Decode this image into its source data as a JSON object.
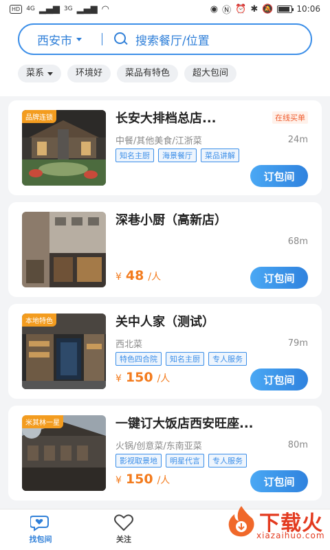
{
  "status_bar": {
    "left_badge": "HD",
    "signal_1": "4G",
    "signal_2": "3G",
    "time": "10:06"
  },
  "search": {
    "city": "西安市",
    "placeholder": "搜索餐厅/位置"
  },
  "filters": [
    "菜系",
    "环境好",
    "菜品有特色",
    "超大包间"
  ],
  "restaurants": [
    {
      "badge": "品牌连锁",
      "name": "长安大排档总店...",
      "online_label": "在线买单",
      "cuisine": "中餐/其他美食/江浙菜",
      "distance": "24m",
      "tags": [
        "知名主厨",
        "海景餐厅",
        "菜品讲解"
      ],
      "price_symbol": "",
      "price": "",
      "price_unit": "",
      "button": "订包间"
    },
    {
      "badge": "",
      "name": "深巷小厨（高新店）",
      "online_label": "",
      "cuisine": "",
      "distance": "68m",
      "tags": [],
      "price_symbol": "¥",
      "price": "48",
      "price_unit": "/人",
      "button": "订包间"
    },
    {
      "badge": "本地特色",
      "name": "关中人家（测试）",
      "online_label": "",
      "cuisine": "西北菜",
      "distance": "79m",
      "tags": [
        "特色四合院",
        "知名主厨",
        "专人服务"
      ],
      "price_symbol": "¥",
      "price": "150",
      "price_unit": "/人",
      "button": "订包间"
    },
    {
      "badge": "米其林一星",
      "name": "一键订大饭店西安旺座...",
      "online_label": "",
      "cuisine": "火锅/创意菜/东南亚菜",
      "distance": "80m",
      "tags": [
        "影视取景地",
        "明星代言",
        "专人服务"
      ],
      "price_symbol": "¥",
      "price": "150",
      "price_unit": "/人",
      "button": "订包间"
    }
  ],
  "tabbar": {
    "find": "找包间",
    "follow": "关注"
  },
  "watermark": {
    "text": "下载火",
    "sub": "xiazaihuo.com"
  },
  "colors": {
    "accent": "#2f7fd8",
    "price": "#f37b1d",
    "badge": "#f39c1f",
    "watermark": "#e33a1f"
  }
}
